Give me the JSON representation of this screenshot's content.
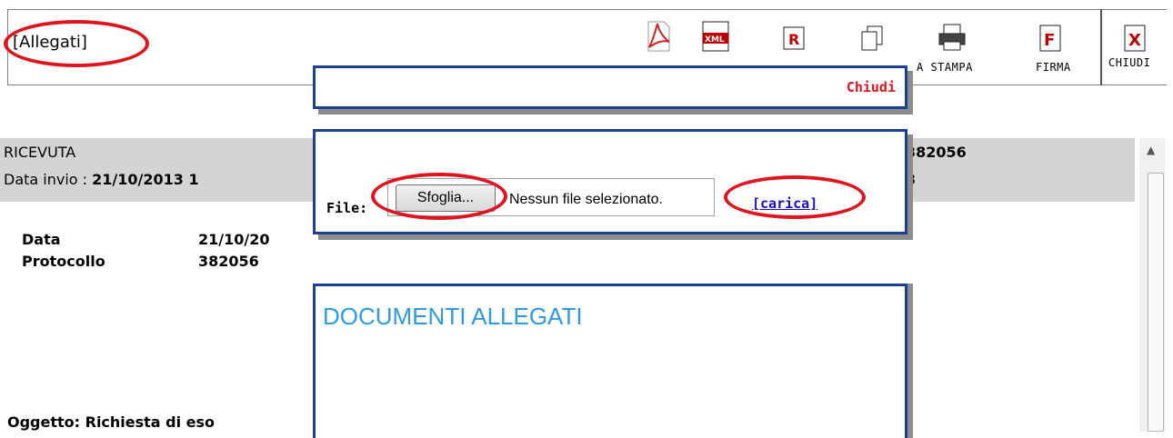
{
  "toolbar": {
    "allegati": "[Allegati]",
    "buttons": [
      {
        "icon": "pdf-icon",
        "label": ""
      },
      {
        "icon": "xml-icon",
        "glyph": "XML",
        "label": ""
      },
      {
        "icon": "r-icon",
        "glyph": "R",
        "label": ""
      },
      {
        "icon": "copy-icon",
        "label": ""
      },
      {
        "icon": "printer-icon",
        "label": "A STAMPA"
      },
      {
        "icon": "firma-icon",
        "glyph": "F",
        "label": "FIRMA"
      },
      {
        "icon": "chiudi-icon",
        "glyph": "X",
        "label": "CHIUDI"
      }
    ]
  },
  "receipt": {
    "title": "RICEVUTA",
    "protocol_partial": "382056",
    "date_label": "Data invio : ",
    "date_value": "21/10/2013 1",
    "date_value_suffix": "3",
    "data_label": "Data",
    "data_value": "21/10/20",
    "protocollo_label": "Protocollo",
    "protocollo_value": "382056",
    "oggetto": "Oggetto: Richiesta di eso"
  },
  "popup": {
    "chiudi": "Chiudi",
    "file_label": "File:",
    "browse": "Sfoglia...",
    "no_file": "Nessun file selezionato.",
    "carica": "[carica]",
    "docs_title": "DOCUMENTI ALLEGATI"
  },
  "colors": {
    "frame": "#1c3f94",
    "annotation": "#e0141e",
    "chiudi": "#e0141e",
    "link": "#1a0dcc",
    "docs_title": "#2e9ae6",
    "receipt_bg": "#d4d4d4"
  }
}
